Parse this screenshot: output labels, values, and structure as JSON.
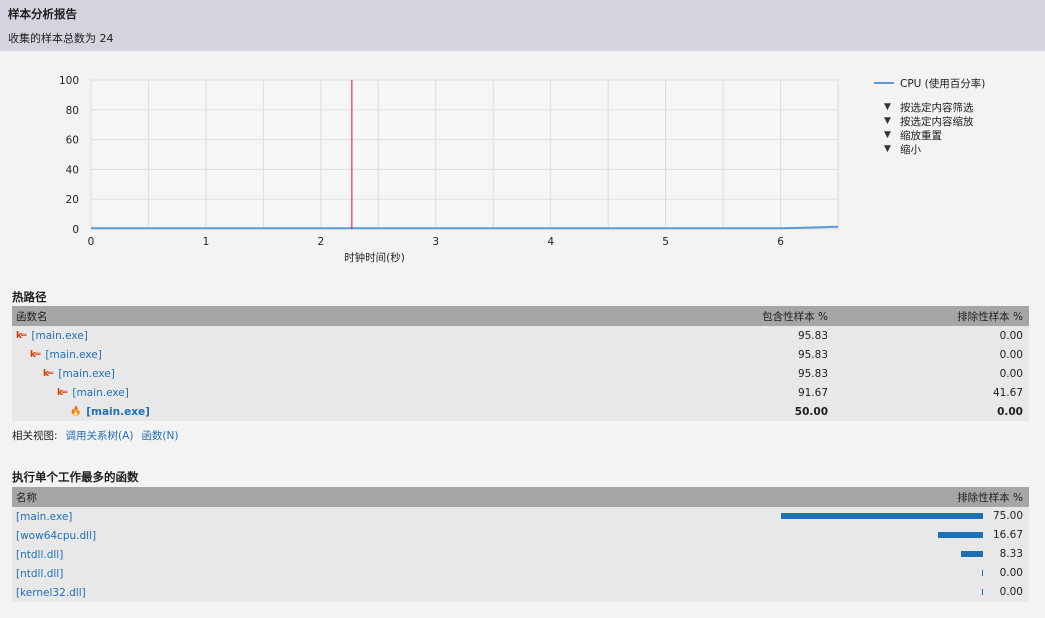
{
  "header": {
    "title": "样本分析报告",
    "subtitle": "收集的样本总数为 24"
  },
  "chart_data": {
    "type": "line",
    "title": "",
    "xlabel": "时钟时间(秒)",
    "ylabel": "",
    "xlim": [
      0,
      6.5
    ],
    "ylim": [
      0,
      100
    ],
    "x_ticks": [
      "0",
      "1",
      "2",
      "3",
      "4",
      "5",
      "6"
    ],
    "y_ticks": [
      "100",
      "80",
      "60",
      "40",
      "20",
      "0"
    ],
    "series": [
      {
        "name": "CPU (使用百分率)",
        "x": [
          0,
          1,
          2,
          3,
          4,
          5,
          6,
          6.2,
          6.5
        ],
        "y": [
          0.5,
          0.5,
          0.5,
          0.5,
          0.5,
          0.5,
          0.5,
          0.8,
          1.5
        ]
      }
    ],
    "marker_x": 2.27,
    "grid": true,
    "colors": {
      "series": "#5b9bd5",
      "marker": "#e81123"
    }
  },
  "legend": {
    "series_label": "CPU (使用百分率)",
    "commands": [
      "按选定内容筛选",
      "按选定内容缩放",
      "缩放重置",
      "缩小"
    ]
  },
  "hotpath": {
    "title": "热路径",
    "columns": [
      "函数名",
      "包含性样本 %",
      "排除性样本 %"
    ],
    "rows": [
      {
        "name": "[main.exe]",
        "inc": "95.83",
        "exc": "0.00"
      },
      {
        "name": "[main.exe]",
        "inc": "95.83",
        "exc": "0.00"
      },
      {
        "name": "[main.exe]",
        "inc": "95.83",
        "exc": "0.00"
      },
      {
        "name": "[main.exe]",
        "inc": "91.67",
        "exc": "41.67"
      },
      {
        "name": "[main.exe]",
        "inc": "50.00",
        "exc": "0.00"
      }
    ]
  },
  "related": {
    "label": "相关视图:",
    "link1": "调用关系树(A)",
    "link2": "函数(N)"
  },
  "topfuncs": {
    "title": "执行单个工作最多的函数",
    "columns": [
      "名称",
      "排除性样本 %"
    ],
    "rows": [
      {
        "name": "[main.exe]",
        "value": 75.0,
        "label": "75.00"
      },
      {
        "name": "[wow64cpu.dll]",
        "value": 16.67,
        "label": "16.67"
      },
      {
        "name": "[ntdll.dll]",
        "value": 8.33,
        "label": "8.33"
      },
      {
        "name": "[ntdll.dll]",
        "value": 0.0,
        "label": "0.00"
      },
      {
        "name": "[kernel32.dll]",
        "value": 0.0,
        "label": "0.00"
      }
    ]
  }
}
